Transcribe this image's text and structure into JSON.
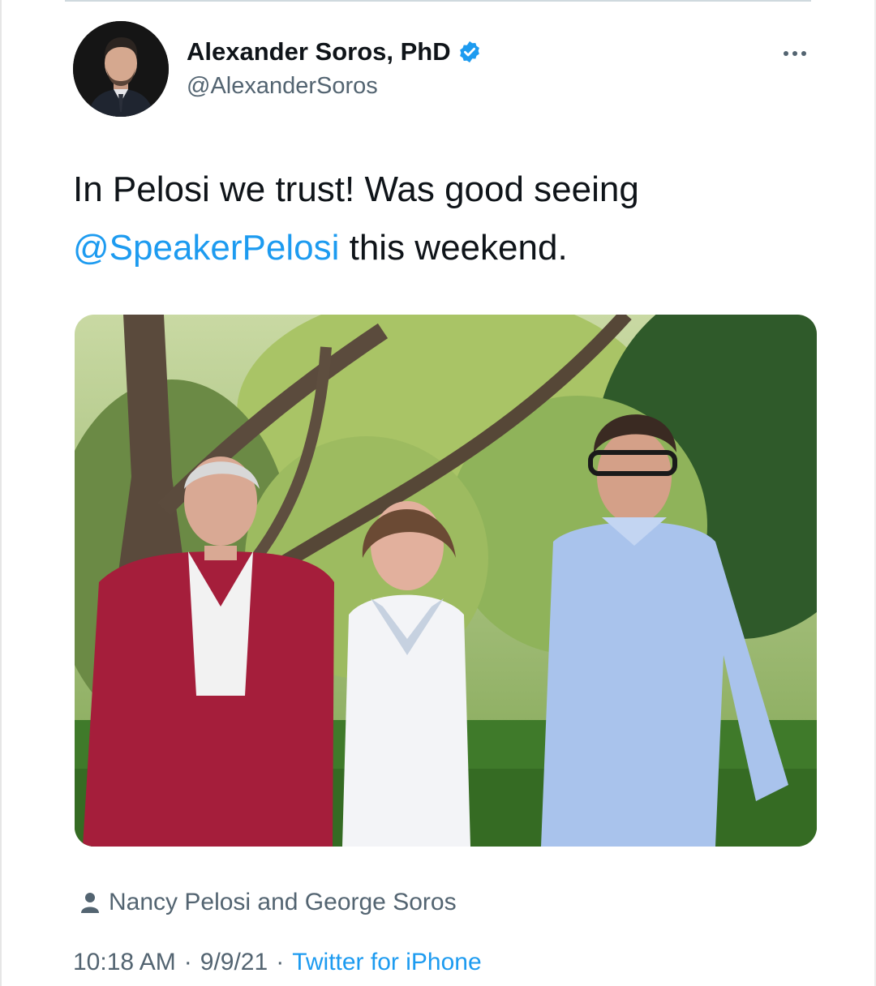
{
  "tweet": {
    "author": {
      "display_name": "Alexander Soros, PhD",
      "handle": "@AlexanderSoros",
      "verified": true
    },
    "text_prefix": "In Pelosi we trust! Was good seeing",
    "mention": "@SpeakerPelosi",
    "text_suffix": " this weekend.",
    "tagged_people": "Nancy Pelosi and George Soros",
    "time": "10:18 AM",
    "date": "9/9/21",
    "source": "Twitter for iPhone",
    "separator": "·"
  },
  "icons": {
    "verified": "verified-badge-icon",
    "more": "more-options-icon",
    "tag": "person-icon"
  },
  "colors": {
    "link": "#1d9bf0",
    "secondary_text": "#536471",
    "primary_text": "#0f1419"
  }
}
